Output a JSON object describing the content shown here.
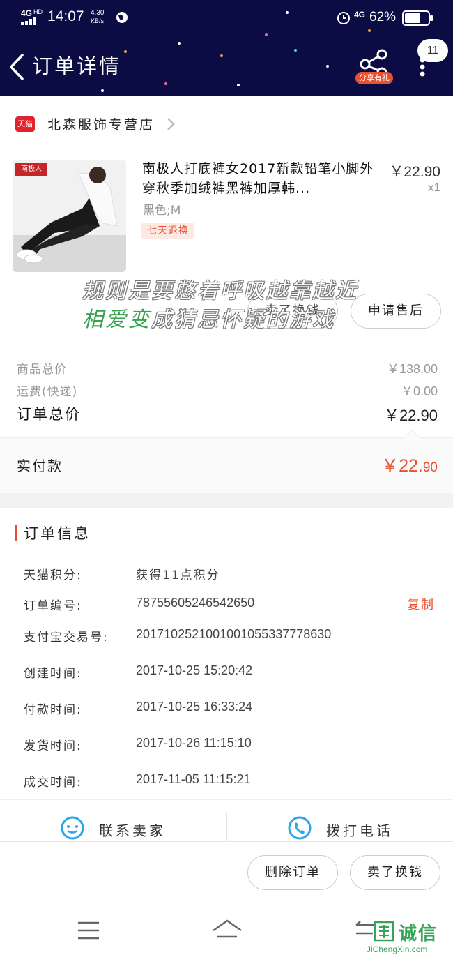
{
  "status_bar": {
    "network": "4G",
    "network_sup": "HD",
    "time": "14:07",
    "speed": "4.30",
    "speed_unit": "KB/s",
    "network_right": "4G",
    "battery": "62%"
  },
  "header": {
    "title": "订单详情",
    "share_label": "分享有礼",
    "message_count": "11"
  },
  "shop": {
    "badge": "天猫",
    "name": "北森服饰专营店"
  },
  "product": {
    "brand_logo": "南极人",
    "title": "南极人打底裤女2017新款铅笔小脚外穿秋季加绒裤黑裤加厚韩...",
    "price": "￥22.90",
    "quantity": "x1",
    "spec": "黑色;M",
    "return_policy": "七天退换"
  },
  "actions_top": {
    "sell": "卖了换钱",
    "after_sale": "申请售后"
  },
  "lyrics": {
    "line1": "规则是要憋着呼吸越靠越近",
    "line2_highlight": "相爱变",
    "line2_rest": "成猜忌怀疑的游戏"
  },
  "summary": {
    "goods_total_label": "商品总价",
    "goods_total_value": "￥138.00",
    "shipping_label": "运费(快递)",
    "shipping_value": "￥0.00",
    "order_total_label": "订单总价",
    "order_total_value": "￥22.90",
    "paid_label": "实付款",
    "paid_value_main": "￥22.",
    "paid_value_cents": "90"
  },
  "order_info": {
    "title": "订单信息",
    "copy_label": "复制",
    "rows": [
      {
        "label": "天猫积分:",
        "value": "获得11点积分"
      },
      {
        "label": "订单编号:",
        "value": "78755605246542650"
      },
      {
        "label": "支付宝交易号:",
        "value": "2017102521001001055337778630"
      },
      {
        "label": "创建时间:",
        "value": "2017-10-25 15:20:42"
      },
      {
        "label": "付款时间:",
        "value": "2017-10-25 16:33:24"
      },
      {
        "label": "发货时间:",
        "value": "2017-10-26 11:15:10"
      },
      {
        "label": "成交时间:",
        "value": "2017-11-05 11:15:21"
      }
    ]
  },
  "contact": {
    "seller": "联系卖家",
    "call": "拨打电话"
  },
  "bottom_actions": {
    "delete": "删除订单",
    "sell": "卖了换钱"
  },
  "watermark": {
    "cn": "诚信",
    "en": "JiChengXin.com"
  },
  "colors": {
    "header_bg": "#0b0c44",
    "accent": "#e8502f",
    "tmall_red": "#e0242d",
    "lyric_green": "#37a14d"
  }
}
